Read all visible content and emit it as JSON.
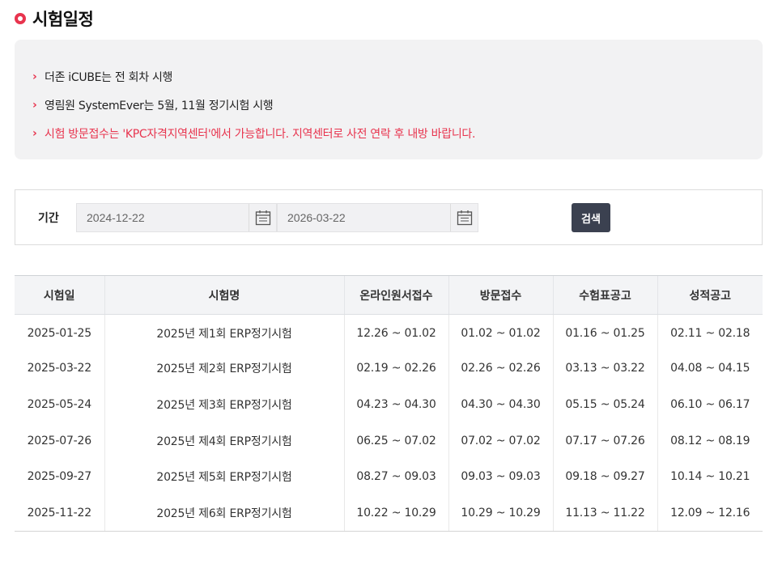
{
  "page": {
    "title": "시험일정"
  },
  "notices": [
    {
      "text": "더존 iCUBE는 전 회차 시행",
      "highlight": false
    },
    {
      "text": "영림원 SystemEver는 5월, 11월 정기시험 시행",
      "highlight": false
    },
    {
      "text": "시험 방문접수는 'KPC자격지역센터'에서 가능합니다. 지역센터로 사전 연락 후 내방 바랍니다.",
      "highlight": true
    }
  ],
  "search": {
    "period_label": "기간",
    "start_date": "2024-12-22",
    "end_date": "2026-03-22",
    "calendar_icon": "calendar-icon",
    "button_label": "검색"
  },
  "table": {
    "headers": [
      "시험일",
      "시험명",
      "온라인원서접수",
      "방문접수",
      "수험표공고",
      "성적공고"
    ],
    "rows": [
      [
        "2025-01-25",
        "2025년 제1회 ERP정기시험",
        "12.26 ~ 01.02",
        "01.02 ~ 01.02",
        "01.16 ~ 01.25",
        "02.11 ~ 02.18"
      ],
      [
        "2025-03-22",
        "2025년 제2회 ERP정기시험",
        "02.19 ~ 02.26",
        "02.26 ~ 02.26",
        "03.13 ~ 03.22",
        "04.08 ~ 04.15"
      ],
      [
        "2025-05-24",
        "2025년 제3회 ERP정기시험",
        "04.23 ~ 04.30",
        "04.30 ~ 04.30",
        "05.15 ~ 05.24",
        "06.10 ~ 06.17"
      ],
      [
        "2025-07-26",
        "2025년 제4회 ERP정기시험",
        "06.25 ~ 07.02",
        "07.02 ~ 07.02",
        "07.17 ~ 07.26",
        "08.12 ~ 08.19"
      ],
      [
        "2025-09-27",
        "2025년 제5회 ERP정기시험",
        "08.27 ~ 09.03",
        "09.03 ~ 09.03",
        "09.18 ~ 09.27",
        "10.14 ~ 10.21"
      ],
      [
        "2025-11-22",
        "2025년 제6회 ERP정기시험",
        "10.22 ~ 10.29",
        "10.29 ~ 10.29",
        "11.13 ~ 11.22",
        "12.09 ~ 12.16"
      ]
    ]
  },
  "colors": {
    "accent": "#e8344e",
    "button": "#3b4150",
    "notice_bg": "#f2f2f3"
  }
}
